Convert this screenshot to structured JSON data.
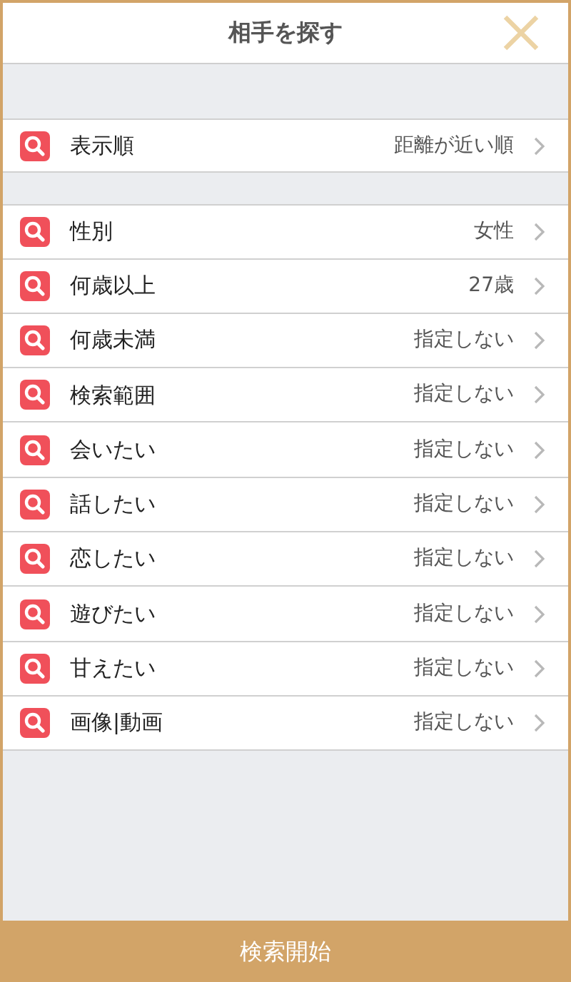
{
  "header": {
    "title": "相手を探す"
  },
  "sections": [
    {
      "rows": [
        {
          "label": "表示順",
          "value": "距離が近い順"
        }
      ]
    },
    {
      "rows": [
        {
          "label": "性別",
          "value": "女性"
        },
        {
          "label": "何歳以上",
          "value": "27歳"
        },
        {
          "label": "何歳未満",
          "value": "指定しない"
        },
        {
          "label": "検索範囲",
          "value": "指定しない"
        },
        {
          "label": "会いたい",
          "value": "指定しない"
        },
        {
          "label": "話したい",
          "value": "指定しない"
        },
        {
          "label": "恋したい",
          "value": "指定しない"
        },
        {
          "label": "遊びたい",
          "value": "指定しない"
        },
        {
          "label": "甘えたい",
          "value": "指定しない"
        },
        {
          "label": "画像|動画",
          "value": "指定しない"
        }
      ]
    }
  ],
  "button": {
    "label": "検索開始"
  }
}
